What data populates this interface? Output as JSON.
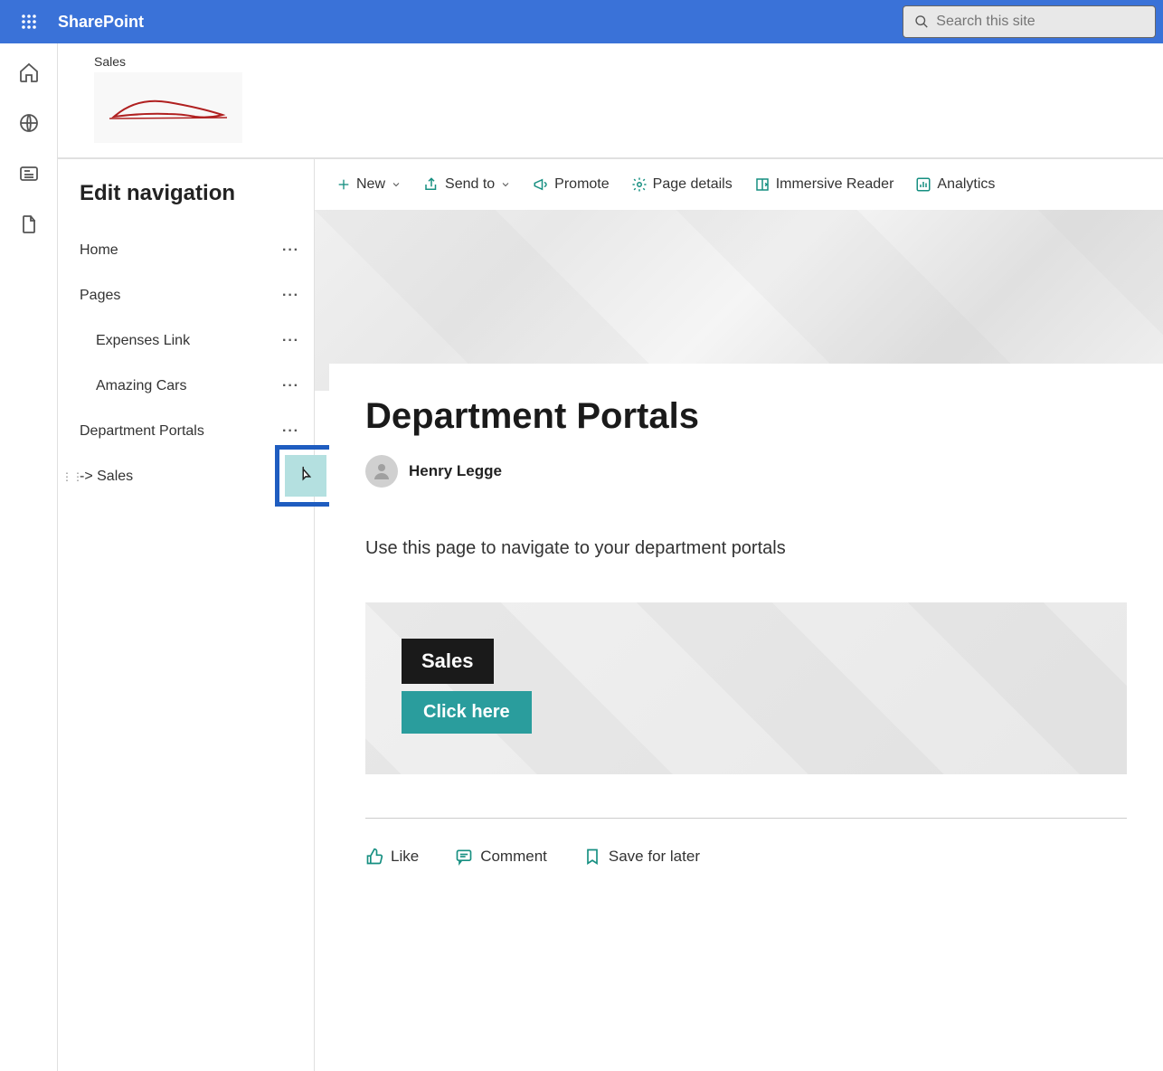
{
  "brand": "SharePoint",
  "search": {
    "placeholder": "Search this site"
  },
  "site": {
    "label": "Sales"
  },
  "nav": {
    "title": "Edit navigation",
    "items": [
      {
        "label": "Home",
        "sub": false
      },
      {
        "label": "Pages",
        "sub": false
      },
      {
        "label": "Expenses Link",
        "sub": true
      },
      {
        "label": "Amazing Cars",
        "sub": true
      },
      {
        "label": "Department Portals",
        "sub": false
      },
      {
        "label": "-> Sales",
        "sub": false
      }
    ]
  },
  "commands": {
    "new": "New",
    "send": "Send to",
    "promote": "Promote",
    "details": "Page details",
    "reader": "Immersive Reader",
    "analytics": "Analytics"
  },
  "page": {
    "title": "Department Portals",
    "author": "Henry Legge",
    "description": "Use this page to navigate to your department portals",
    "tile": {
      "label": "Sales",
      "button": "Click here"
    }
  },
  "actions": {
    "like": "Like",
    "comment": "Comment",
    "save": "Save for later"
  }
}
